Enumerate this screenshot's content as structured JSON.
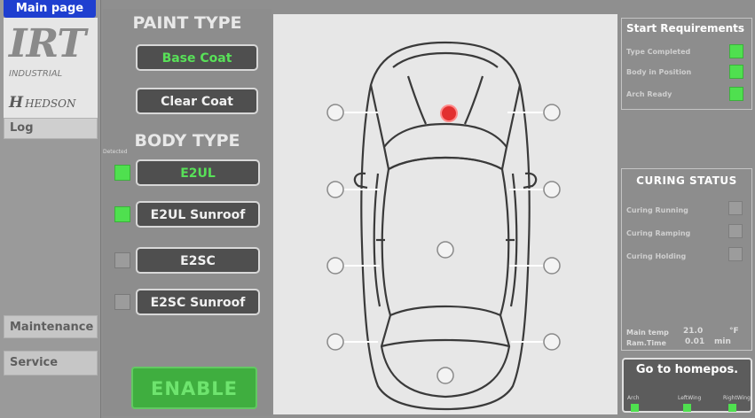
{
  "sidebar": {
    "main_page": "Main page",
    "logo_irt": "IRT",
    "logo_industrial": "INDUSTRIAL",
    "logo_hedson": "HEDSON",
    "log": "Log",
    "maintenance": "Maintenance",
    "service": "Service"
  },
  "paint": {
    "heading": "PAINT TYPE",
    "base_coat": "Base Coat",
    "clear_coat": "Clear Coat"
  },
  "body": {
    "heading": "BODY TYPE",
    "detected_label": "Detected",
    "options": [
      {
        "label": "E2UL",
        "checked": true,
        "selected": true
      },
      {
        "label": "E2UL Sunroof",
        "checked": true,
        "selected": false
      },
      {
        "label": "E2SC",
        "checked": false,
        "selected": false
      },
      {
        "label": "E2SC Sunroof",
        "checked": false,
        "selected": false
      }
    ]
  },
  "enable": "ENABLE",
  "start_requirements": {
    "title": "Start Requirements",
    "items": [
      {
        "label": "Type Completed",
        "ok": true
      },
      {
        "label": "Body in Position",
        "ok": true
      },
      {
        "label": "Arch Ready",
        "ok": true
      }
    ]
  },
  "curing": {
    "title": "CURING STATUS",
    "items": [
      {
        "label": "Curing Running",
        "on": false
      },
      {
        "label": "Curing Ramping",
        "on": false
      },
      {
        "label": "Curing Holding",
        "on": false
      }
    ],
    "main_temp_label": "Main temp",
    "main_temp_value": "21.0",
    "main_temp_unit": "°F",
    "ramp_time_label": "Ram.Time",
    "ramp_time_value": "0.01",
    "ramp_time_unit": "min"
  },
  "homepos": {
    "label": "Go to homepos.",
    "arch": "Arch",
    "left_wing": "LeftWing",
    "right_wing": "RightWing"
  },
  "colors": {
    "active_green": "#4fe04f",
    "sensor_active_red": "#e23030",
    "main_page_blue": "#1f3fd0"
  },
  "sensors": {
    "active": "top-center-red"
  }
}
